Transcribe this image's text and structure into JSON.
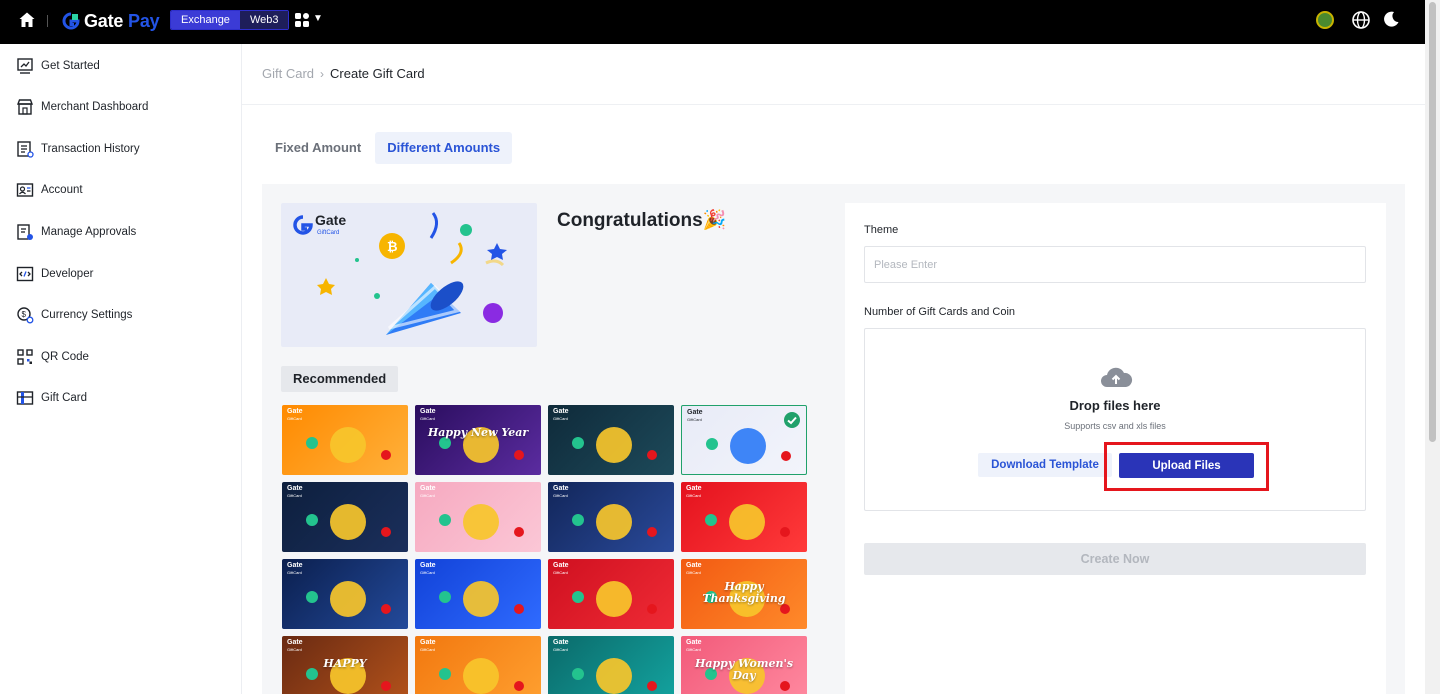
{
  "topbar": {
    "brand_name": "Gate",
    "brand_suffix": "Pay",
    "switcher": [
      "Exchange",
      "Web3"
    ],
    "colors": {
      "background": "#000000",
      "brand_blue": "#2354e6"
    }
  },
  "sidebar": {
    "items": [
      {
        "label": "Get Started",
        "icon": "dashboard-chart-icon"
      },
      {
        "label": "Merchant Dashboard",
        "icon": "storefront-icon"
      },
      {
        "label": "Transaction History",
        "icon": "list-document-icon"
      },
      {
        "label": "Account",
        "icon": "id-card-icon"
      },
      {
        "label": "Manage Approvals",
        "icon": "approval-document-icon"
      },
      {
        "label": "Developer",
        "icon": "code-icon"
      },
      {
        "label": "Currency Settings",
        "icon": "currency-gear-icon"
      },
      {
        "label": "QR Code",
        "icon": "qr-code-icon"
      },
      {
        "label": "Gift Card",
        "icon": "gift-card-icon"
      }
    ]
  },
  "breadcrumb": {
    "parent": "Gift Card",
    "separator": "›",
    "current": "Create Gift Card"
  },
  "tabs": [
    {
      "label": "Fixed Amount",
      "active": false
    },
    {
      "label": "Different Amounts",
      "active": true
    }
  ],
  "preview": {
    "brand": "Gate",
    "brand_sub": "GiftCard",
    "title": "Congratulations🎉"
  },
  "recommended": {
    "label": "Recommended",
    "cards": [
      {
        "theme": "birthday-cake",
        "colors": [
          "#ff8a00",
          "#ffb13b"
        ],
        "text": "",
        "selected": false
      },
      {
        "theme": "happy-new-year",
        "colors": [
          "#2a0d5e",
          "#5b2ca0"
        ],
        "text": "Happy New Year",
        "selected": false
      },
      {
        "theme": "fireworks",
        "colors": [
          "#0f2a3a",
          "#1d4a5a"
        ],
        "text": "",
        "selected": false
      },
      {
        "theme": "party-popper",
        "colors": [
          "#e8ebf7",
          "#f2f4fb"
        ],
        "text": "",
        "selected": true
      },
      {
        "theme": "christmas-gift",
        "colors": [
          "#0d1f3d",
          "#1b2f5c"
        ],
        "text": "",
        "selected": false
      },
      {
        "theme": "love-envelope",
        "colors": [
          "#f6a9c0",
          "#fbc7d6"
        ],
        "text": "",
        "selected": false
      },
      {
        "theme": "santa-coin",
        "colors": [
          "#12265a",
          "#2a4a9a"
        ],
        "text": "",
        "selected": false
      },
      {
        "theme": "red-packet",
        "colors": [
          "#e4121e",
          "#ff3a3a"
        ],
        "text": "",
        "selected": false
      },
      {
        "theme": "moon-festival",
        "colors": [
          "#0b1f4e",
          "#234a9b"
        ],
        "text": "",
        "selected": false
      },
      {
        "theme": "bitcoin-coin",
        "colors": [
          "#1242d8",
          "#2f6bff"
        ],
        "text": "",
        "selected": false
      },
      {
        "theme": "rabbit-coin",
        "colors": [
          "#cf1020",
          "#ef2b35"
        ],
        "text": "",
        "selected": false
      },
      {
        "theme": "thanksgiving",
        "colors": [
          "#f25a12",
          "#ff8a2a"
        ],
        "text": "Happy Thanksgiving",
        "selected": false
      },
      {
        "theme": "happy-thanksgiving-2",
        "colors": [
          "#6a2a12",
          "#b4531b"
        ],
        "text": "HAPPY",
        "selected": false
      },
      {
        "theme": "halloween",
        "colors": [
          "#f2780f",
          "#ffa030"
        ],
        "text": "",
        "selected": false
      },
      {
        "theme": "haunted-castle",
        "colors": [
          "#0b6a6a",
          "#13a4a0"
        ],
        "text": "",
        "selected": false
      },
      {
        "theme": "womens-day",
        "colors": [
          "#f25a7a",
          "#ff8aa0"
        ],
        "text": "Happy Women's Day",
        "selected": false
      }
    ]
  },
  "form": {
    "theme_label": "Theme",
    "theme_placeholder": "Please Enter",
    "theme_value": "",
    "count_label": "Number of Gift Cards and Coin",
    "drop_title": "Drop files here",
    "drop_subtitle": "Supports csv and xls files",
    "download_template": "Download Template",
    "upload_files": "Upload Files",
    "create_now": "Create Now",
    "create_disabled": true
  },
  "annotation": {
    "highlight_color": "#e5161d",
    "target": "upload-files-button"
  }
}
